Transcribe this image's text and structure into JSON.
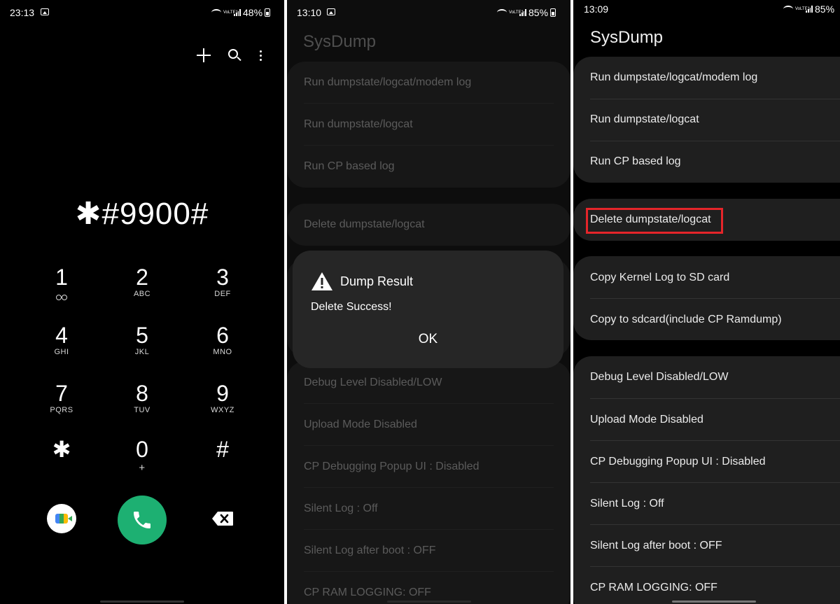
{
  "dialer": {
    "status": {
      "time": "23:13",
      "battery": "48%",
      "volte": "VoLTE1"
    },
    "number": "✱#9900#",
    "keys": [
      {
        "digit": "1",
        "letters": ""
      },
      {
        "digit": "2",
        "letters": "ABC"
      },
      {
        "digit": "3",
        "letters": "DEF"
      },
      {
        "digit": "4",
        "letters": "GHI"
      },
      {
        "digit": "5",
        "letters": "JKL"
      },
      {
        "digit": "6",
        "letters": "MNO"
      },
      {
        "digit": "7",
        "letters": "PQRS"
      },
      {
        "digit": "8",
        "letters": "TUV"
      },
      {
        "digit": "9",
        "letters": "WXYZ"
      },
      {
        "digit": "✱",
        "letters": ""
      },
      {
        "digit": "0",
        "letters": "+"
      },
      {
        "digit": "#",
        "letters": ""
      }
    ],
    "icons": [
      "plus-icon",
      "search-icon",
      "more-vert-icon",
      "voicemail-icon",
      "google-meet-icon",
      "phone-icon",
      "backspace-icon"
    ],
    "call_color": "#1db072"
  },
  "sysdump_dialog": {
    "status": {
      "time": "13:10",
      "battery": "85%",
      "volte": "VoLTE1"
    },
    "title": "SysDump",
    "group1": [
      "Run dumpstate/logcat/modem log",
      "Run dumpstate/logcat",
      "Run CP based log"
    ],
    "group2": [
      "Delete dumpstate/logcat"
    ],
    "group4": [
      "Debug Level Disabled/LOW",
      "Upload Mode Disabled",
      "CP Debugging Popup UI : Disabled",
      "Silent Log : Off",
      "Silent Log after boot : OFF",
      "CP RAM LOGGING: OFF"
    ],
    "dialog": {
      "title": "Dump Result",
      "message": "Delete Success!",
      "ok": "OK"
    }
  },
  "sysdump": {
    "status": {
      "time": "13:09",
      "battery": "85%",
      "volte": "VoLTE1"
    },
    "title": "SysDump",
    "group1": [
      "Run dumpstate/logcat/modem log",
      "Run dumpstate/logcat",
      "Run CP based log"
    ],
    "group2": [
      "Delete dumpstate/logcat"
    ],
    "group3": [
      "Copy Kernel Log to SD card",
      "Copy to sdcard(include CP Ramdump)"
    ],
    "group4": [
      "Debug Level Disabled/LOW",
      "Upload Mode Disabled",
      "CP Debugging Popup UI : Disabled",
      "Silent Log : Off",
      "Silent Log after boot : OFF",
      "CP RAM LOGGING: OFF"
    ],
    "highlight_color": "#e5252a"
  }
}
